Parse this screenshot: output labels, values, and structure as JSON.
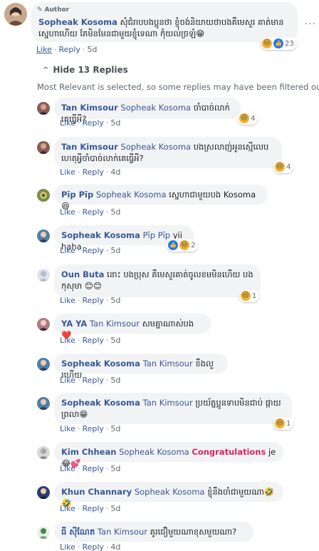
{
  "main": {
    "badge": "Author",
    "author": "Sopheak Kosoma",
    "text": "សុំជំរាបបងប្អូនថា ខ្ញុំចង់និយាយថាបងគឺមេសួរ គាត់មានស្នេហាហើយ តែមិនមែនជាមួយខ្ញុំទេណា កុំយល់ច្រឡំ😁",
    "reaction_count": "23",
    "actions": {
      "like": "Like",
      "reply": "Reply",
      "time": "5d"
    }
  },
  "hide_replies": "Hide 13 Replies",
  "notice": "Most Relevant is selected, so some replies may have been filtered out.",
  "replies": [
    {
      "name": "Tan Kimsour",
      "mention": "Sopheak Kosoma",
      "text": "ចាំបាច់លាក់គេធ្វើអី?",
      "reaction": "4",
      "like": "Like",
      "reply": "Reply",
      "time": "5d"
    },
    {
      "name": "Tan Kimsour",
      "mention": "Sopheak Kosoma",
      "text": "បងស្រលាញ់អូនស្មើលេប ហេតុអ្វីចាំបាច់លាក់គេធ្វើអី?",
      "reaction": "4",
      "like": "Like",
      "reply": "Reply",
      "time": "4d"
    },
    {
      "name": "Pīp Pīp",
      "mention": "Sopheak Kosoma",
      "text": "ស្នេហាជាមួយបង Kosoma😆",
      "like": "Like",
      "reply": "Reply",
      "time": "5d"
    },
    {
      "name": "Sopheak Kosoma",
      "mention": "Pīp Pīp",
      "text": "yii haha",
      "reaction": "2",
      "like": "Like",
      "reply": "Reply",
      "time": "5d"
    },
    {
      "name": "Oun Buta",
      "mention": "",
      "text": "នោះ បងប្រុស គឺមេសួរគាត់ចូលខមមិនហើយ បងកុសុមា 😊😊",
      "reaction": "1",
      "like": "Like",
      "reply": "Reply",
      "time": "5d"
    },
    {
      "name": "YA YA",
      "mention": "Tan Kimsour",
      "text": "សមគ្នាណាស់បង ❤️",
      "like": "Like",
      "reply": "Reply",
      "time": "5d"
    },
    {
      "name": "Sopheak Kosoma",
      "mention": "Tan Kimsour",
      "text": "ខឹងលួរហើយ",
      "like": "Like",
      "reply": "Reply",
      "time": "5d"
    },
    {
      "name": "Sopheak Kosoma",
      "mention": "Tan Kimsour",
      "text": "ប្រយ័ត្នប្អូនទាបមិនជាប់ ផ្កាយព្រលា😁",
      "reaction": "1",
      "like": "Like",
      "reply": "Reply",
      "time": "5d"
    },
    {
      "name": "Kim Chhean",
      "mention": "Sopheak Kosoma",
      "congrats": "Congratulations",
      "text": "je 😂💕",
      "like": "Like",
      "reply": "Reply",
      "time": "5d"
    },
    {
      "name": "Khun Channary",
      "mention": "Sopheak Kosoma",
      "text": "ខ្ញុំនឹងចាំជាមួយណា🤣🤣",
      "like": "Like",
      "reply": "Reply",
      "time": "5d"
    },
    {
      "name": "ធី ស៊ីណែត",
      "mention": "Tan Kimsour",
      "text": "គូរជឿមួយណាខុសមួយណា?",
      "like": "Like",
      "reply": "Reply",
      "time": "4d"
    }
  ],
  "colors": {
    "link": "#385898",
    "bubble": "#f2f3f5",
    "meta": "#606770",
    "haha": "#f7b125",
    "like": "#2078f4"
  }
}
